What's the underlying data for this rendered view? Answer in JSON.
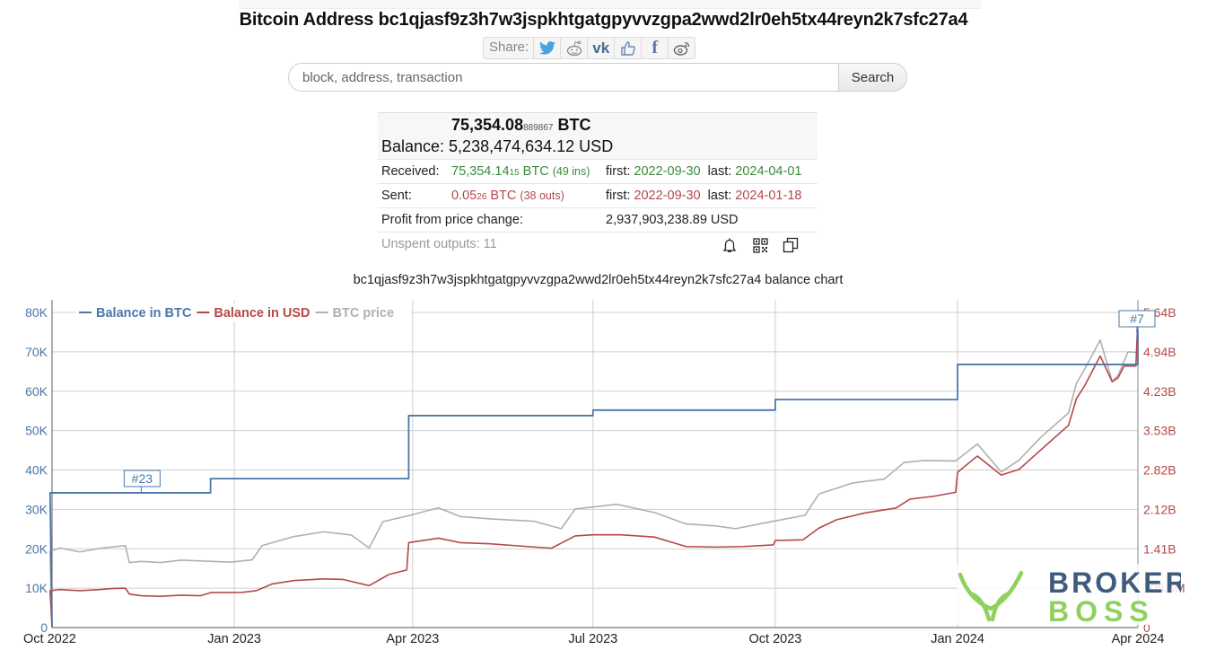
{
  "page": {
    "title": "Bitcoin Address bc1qjasf9z3h7w3jspkhtgatgpyvvzgpa2wwd2lr0eh5tx44reyn2k7sfc27a4"
  },
  "share": {
    "label": "Share:",
    "icons": [
      "twitter-icon",
      "reddit-icon",
      "vk-icon",
      "like-icon",
      "facebook-icon",
      "weibo-icon"
    ]
  },
  "search": {
    "placeholder": "block, address, transaction",
    "value": "",
    "button_label": "Search"
  },
  "summary": {
    "balance_btc_main": "75,354.08",
    "balance_btc_tail": "889867",
    "balance_btc_unit": "BTC",
    "balance_usd": "Balance: 5,238,474,634.12 USD",
    "received": {
      "label": "Received:",
      "amount_main": "75,354.14",
      "amount_tail": "15",
      "unit": " BTC ",
      "count": "(49 ins)",
      "first_label": "first:",
      "first_date": "2022-09-30",
      "last_label": "last:",
      "last_date": "2024-04-01"
    },
    "sent": {
      "label": "Sent:",
      "amount_main": "0.05",
      "amount_tail": "26",
      "unit": " BTC ",
      "count": "(38 outs)",
      "first_label": "first:",
      "first_date": "2022-09-30",
      "last_label": "last:",
      "last_date": "2024-01-18"
    },
    "profit": {
      "label": "Profit from price change:",
      "value": "2,937,903,238.89 USD"
    },
    "unspent": "Unspent outputs: 11",
    "action_icons": [
      "bell-icon",
      "qr-code-icon",
      "copy-icon"
    ]
  },
  "colors": {
    "btc": "#4a77a8",
    "usd": "#b54848",
    "price": "#b0b0b0",
    "received": "#3d8a3d",
    "sent": "#b54848"
  },
  "chart_data": {
    "type": "line",
    "title": "bc1qjasf9z3h7w3jspkhtgatgpyvvzgpa2wwd2lr0eh5tx44reyn2k7sfc27a4 balance chart",
    "legend": [
      "Balance in BTC",
      "Balance in USD",
      "BTC price"
    ],
    "legend_position": "top-left",
    "grid": true,
    "x_ticks": [
      "Oct 2022",
      "Jan 2023",
      "Apr 2023",
      "Jul 2023",
      "Oct 2023",
      "Jan 2024",
      "Apr 2024"
    ],
    "x_range": [
      "2022-10-01",
      "2024-04-01"
    ],
    "y_left_ticks": [
      "0",
      "10K",
      "20K",
      "30K",
      "40K",
      "50K",
      "60K",
      "70K",
      "80K"
    ],
    "y_left_range": [
      0,
      80000
    ],
    "y_right_ticks": [
      "0",
      "705.5M",
      "1.41B",
      "2.12B",
      "2.82B",
      "3.53B",
      "4.23B",
      "4.94B",
      "5.64B"
    ],
    "y_right_range": [
      0,
      5640000000
    ],
    "annotations": [
      {
        "label": "#23",
        "date": "2022-11-15",
        "series": "Balance in BTC"
      },
      {
        "label": "#7",
        "date": "2024-04-01",
        "series": "Balance in BTC"
      }
    ],
    "series": [
      {
        "name": "Balance in BTC",
        "axis": "left",
        "step": true,
        "points": [
          [
            "2022-09-30",
            34200
          ],
          [
            "2022-12-20",
            37800
          ],
          [
            "2023-03-30",
            53800
          ],
          [
            "2023-07-01",
            55200
          ],
          [
            "2023-10-01",
            57900
          ],
          [
            "2024-01-01",
            66800
          ],
          [
            "2024-04-01",
            75354
          ]
        ]
      },
      {
        "name": "Balance in USD",
        "axis": "right",
        "points": [
          [
            "2022-09-30",
            660000000
          ],
          [
            "2022-10-05",
            680000000
          ],
          [
            "2022-10-15",
            660000000
          ],
          [
            "2022-10-25",
            680000000
          ],
          [
            "2022-11-01",
            700000000
          ],
          [
            "2022-11-07",
            705000000
          ],
          [
            "2022-11-09",
            600000000
          ],
          [
            "2022-11-15",
            570000000
          ],
          [
            "2022-11-25",
            560000000
          ],
          [
            "2022-12-05",
            580000000
          ],
          [
            "2022-12-15",
            570000000
          ],
          [
            "2022-12-20",
            625000000
          ],
          [
            "2023-01-05",
            630000000
          ],
          [
            "2023-01-12",
            660000000
          ],
          [
            "2023-01-20",
            780000000
          ],
          [
            "2023-01-31",
            840000000
          ],
          [
            "2023-02-15",
            870000000
          ],
          [
            "2023-02-25",
            860000000
          ],
          [
            "2023-03-10",
            750000000
          ],
          [
            "2023-03-20",
            950000000
          ],
          [
            "2023-03-29",
            1030000000
          ],
          [
            "2023-03-30",
            1520000000
          ],
          [
            "2023-04-14",
            1600000000
          ],
          [
            "2023-04-25",
            1520000000
          ],
          [
            "2023-05-10",
            1500000000
          ],
          [
            "2023-05-25",
            1460000000
          ],
          [
            "2023-06-10",
            1420000000
          ],
          [
            "2023-06-22",
            1640000000
          ],
          [
            "2023-07-01",
            1660000000
          ],
          [
            "2023-07-15",
            1660000000
          ],
          [
            "2023-08-01",
            1620000000
          ],
          [
            "2023-08-17",
            1450000000
          ],
          [
            "2023-09-01",
            1440000000
          ],
          [
            "2023-09-15",
            1450000000
          ],
          [
            "2023-09-30",
            1480000000
          ],
          [
            "2023-10-01",
            1560000000
          ],
          [
            "2023-10-15",
            1570000000
          ],
          [
            "2023-10-23",
            1780000000
          ],
          [
            "2023-11-01",
            1930000000
          ],
          [
            "2023-11-15",
            2050000000
          ],
          [
            "2023-12-01",
            2140000000
          ],
          [
            "2023-12-08",
            2300000000
          ],
          [
            "2023-12-20",
            2350000000
          ],
          [
            "2023-12-31",
            2420000000
          ],
          [
            "2024-01-01",
            2780000000
          ],
          [
            "2024-01-11",
            3070000000
          ],
          [
            "2024-01-23",
            2730000000
          ],
          [
            "2024-02-01",
            2830000000
          ],
          [
            "2024-02-12",
            3180000000
          ],
          [
            "2024-02-26",
            3620000000
          ],
          [
            "2024-03-01",
            4100000000
          ],
          [
            "2024-03-05",
            4320000000
          ],
          [
            "2024-03-13",
            4860000000
          ],
          [
            "2024-03-19",
            4400000000
          ],
          [
            "2024-03-22",
            4470000000
          ],
          [
            "2024-03-25",
            4680000000
          ],
          [
            "2024-03-31",
            4680000000
          ],
          [
            "2024-04-01",
            5580000000
          ]
        ]
      },
      {
        "name": "BTC price",
        "axis": "left",
        "points": [
          [
            "2022-09-30",
            19400
          ],
          [
            "2022-10-05",
            20200
          ],
          [
            "2022-10-15",
            19200
          ],
          [
            "2022-10-25",
            20100
          ],
          [
            "2022-11-01",
            20500
          ],
          [
            "2022-11-07",
            20800
          ],
          [
            "2022-11-09",
            16500
          ],
          [
            "2022-11-15",
            16800
          ],
          [
            "2022-11-25",
            16500
          ],
          [
            "2022-12-05",
            17100
          ],
          [
            "2022-12-15",
            16900
          ],
          [
            "2022-12-30",
            16600
          ],
          [
            "2023-01-10",
            17200
          ],
          [
            "2023-01-15",
            20800
          ],
          [
            "2023-01-31",
            23100
          ],
          [
            "2023-02-15",
            24300
          ],
          [
            "2023-03-01",
            23500
          ],
          [
            "2023-03-10",
            20200
          ],
          [
            "2023-03-17",
            26900
          ],
          [
            "2023-03-30",
            28400
          ],
          [
            "2023-04-14",
            30400
          ],
          [
            "2023-04-25",
            28200
          ],
          [
            "2023-05-10",
            27600
          ],
          [
            "2023-06-01",
            27000
          ],
          [
            "2023-06-15",
            25100
          ],
          [
            "2023-06-22",
            30100
          ],
          [
            "2023-07-13",
            31300
          ],
          [
            "2023-08-01",
            29200
          ],
          [
            "2023-08-17",
            26300
          ],
          [
            "2023-09-01",
            25800
          ],
          [
            "2023-09-11",
            25100
          ],
          [
            "2023-09-30",
            27000
          ],
          [
            "2023-10-16",
            28500
          ],
          [
            "2023-10-23",
            33900
          ],
          [
            "2023-11-09",
            36700
          ],
          [
            "2023-11-25",
            37700
          ],
          [
            "2023-12-05",
            41900
          ],
          [
            "2023-12-15",
            42400
          ],
          [
            "2023-12-31",
            42300
          ],
          [
            "2024-01-11",
            46600
          ],
          [
            "2024-01-23",
            39500
          ],
          [
            "2024-02-01",
            42500
          ],
          [
            "2024-02-12",
            48300
          ],
          [
            "2024-02-26",
            54500
          ],
          [
            "2024-03-01",
            62000
          ],
          [
            "2024-03-05",
            65500
          ],
          [
            "2024-03-13",
            73000
          ],
          [
            "2024-03-19",
            62500
          ],
          [
            "2024-03-22",
            64000
          ],
          [
            "2024-03-27",
            70000
          ],
          [
            "2024-04-01",
            69800
          ]
        ]
      }
    ]
  }
}
